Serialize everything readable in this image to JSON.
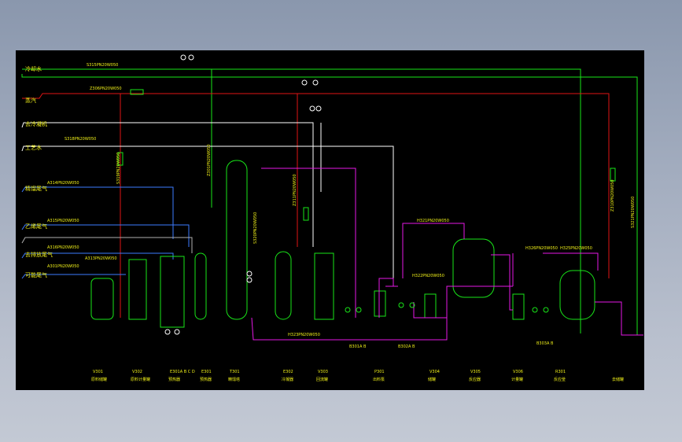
{
  "utility_labels": [
    "冷却水",
    "蒸汽",
    "去冷凝机",
    "工艺水",
    "精馏尾气",
    "乙烯尾气",
    "去排放尾气",
    "可能尾气"
  ],
  "line_labels": {
    "cooling_water": "S315PN20W050",
    "steam": "Z306PN20W050",
    "process_water": "S318PN20W050",
    "n1": "A314PN20W050",
    "n2": "A315PN20W050",
    "n3": "A316PN20W050",
    "n4": "A301PN20W050",
    "n5": "A313PN20W050",
    "v1": "Z301PN20W050",
    "v2": "S319PN20W050",
    "v3": "S320PN20W050",
    "v4": "Z311PN20W050",
    "v5": "H325PN20W050",
    "v6": "H326PN20W050",
    "h1": "H321PN20W050",
    "h2": "H322PN20W050",
    "h3": "H323PN20W050",
    "r1": "Z310PN20W050",
    "r2": "S321PN20W050"
  },
  "pump_labels": [
    "B301A B",
    "B302A B",
    "B303A B"
  ],
  "equipment": [
    {
      "tag": "V301",
      "name": "原料储罐"
    },
    {
      "tag": "V302",
      "name": "原料计量罐"
    },
    {
      "tag": "E301A B C D",
      "name": "预热器"
    },
    {
      "tag": "E301",
      "name": "预热器"
    },
    {
      "tag": "T301",
      "name": "精馏塔"
    },
    {
      "tag": "E302",
      "name": "冷凝器"
    },
    {
      "tag": "V303",
      "name": "回流罐"
    },
    {
      "tag": "P301",
      "name": "出料泵"
    },
    {
      "tag": "V304",
      "name": "储罐"
    },
    {
      "tag": "V305",
      "name": "反应器"
    },
    {
      "tag": "V306",
      "name": "计量罐"
    },
    {
      "tag": "R301",
      "name": "反应釜"
    },
    {
      "tag": "",
      "name": "去储罐"
    }
  ],
  "colors": {
    "cooling_water": "#19e619",
    "steam": "#e01414",
    "gas": "#3d7bff",
    "product": "#e619e6",
    "equipment": "#19e619",
    "text": "#f0f019",
    "white": "#ffffff"
  }
}
